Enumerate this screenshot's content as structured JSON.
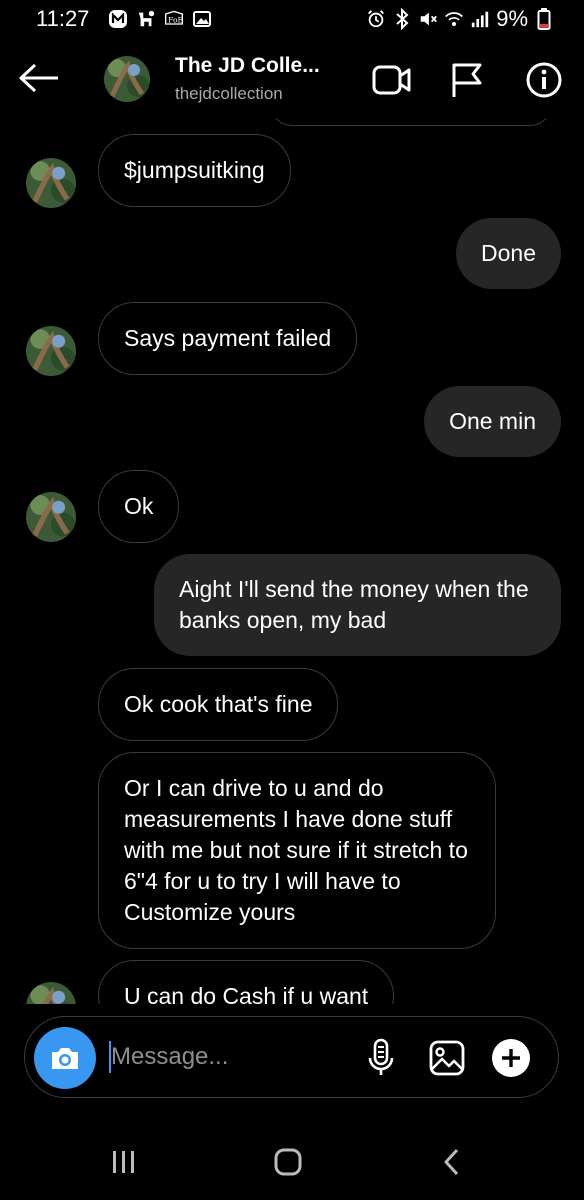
{
  "status_bar": {
    "time": "11:27",
    "battery": "9%",
    "left_icons": [
      "m-app-icon",
      "puppy-icon",
      "foe-icon",
      "image-icon"
    ],
    "right_icons": [
      "alarm-icon",
      "bluetooth-icon",
      "mute-icon",
      "wifi-icon",
      "signal-icon",
      "battery-icon"
    ]
  },
  "header": {
    "title": "The JD Colle...",
    "username": "thejdcollection"
  },
  "messages": [
    {
      "dir": "in",
      "text": "$jumpsuitking",
      "avatar": true
    },
    {
      "dir": "out",
      "text": "Done"
    },
    {
      "dir": "in",
      "text": "Says payment failed",
      "avatar": true
    },
    {
      "dir": "out",
      "text": "One min"
    },
    {
      "dir": "in",
      "text": "Ok",
      "avatar": true
    },
    {
      "dir": "out",
      "text": "Aight I'll send the money when the banks open, my bad"
    },
    {
      "dir": "in",
      "text": "Ok cook that's fine",
      "avatar": false
    },
    {
      "dir": "in",
      "text": "Or I can drive to u and do measurements I have done stuff with me but not sure if it stretch to 6\"4 for u to try I will have to Customize yours",
      "avatar": false
    },
    {
      "dir": "in",
      "text": "U can do Cash if u want",
      "avatar": true
    }
  ],
  "composer": {
    "placeholder": "Message..."
  },
  "colors": {
    "background": "#000000",
    "outgoing_bubble": "#262626",
    "incoming_border": "#3a3a3a",
    "accent_blue": "#3897f0",
    "secondary_text": "#a8a8a8"
  }
}
